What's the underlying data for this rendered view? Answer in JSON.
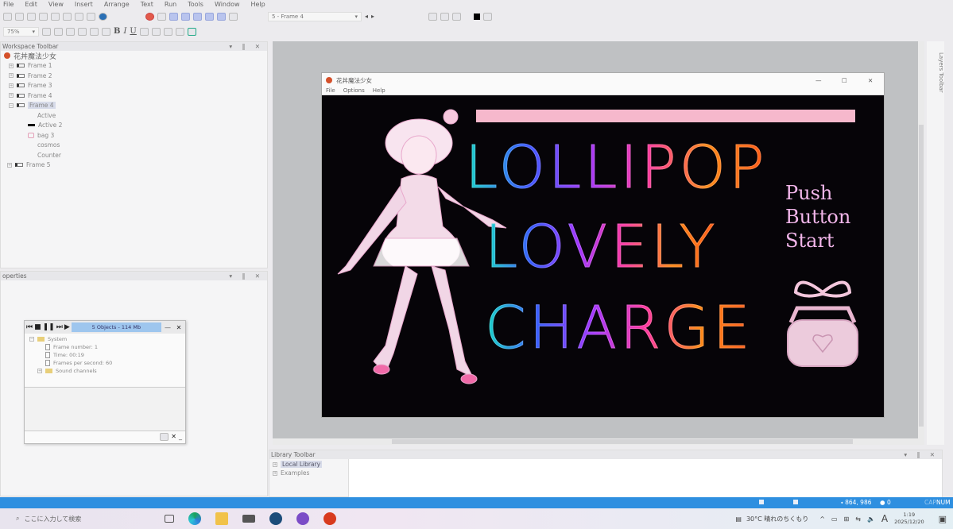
{
  "menu": [
    "File",
    "Edit",
    "View",
    "Insert",
    "Arrange",
    "Text",
    "Run",
    "Tools",
    "Window",
    "Help"
  ],
  "toolbar": {
    "zoom": "75%",
    "frame_select": "5 - Frame 4",
    "bold": "B",
    "italic": "I",
    "underline": "U"
  },
  "workspace": {
    "title": "Workspace Toolbar",
    "app_name": "花丼魔法少女",
    "frames": [
      "Frame 1",
      "Frame 2",
      "Frame 3",
      "Frame 4",
      "Frame 4",
      "Frame 5"
    ],
    "objects": [
      "Active",
      "Active 2",
      "bag 3",
      "cosmos",
      "Counter"
    ]
  },
  "properties": {
    "title": "operties"
  },
  "debugger": {
    "status": "5 Objects - 114 Mb",
    "system": "System",
    "items": [
      "Frame number: 1",
      "Time: 00:19",
      "Frames per second: 60"
    ],
    "sound": "Sound channels"
  },
  "game": {
    "title": "花丼魔法少女",
    "menu": [
      "File",
      "Options",
      "Help"
    ],
    "logo_lines": [
      "LOLLIPOP",
      "LOVELY",
      "CHARGE"
    ],
    "push": [
      "Push",
      "Button",
      "Start"
    ]
  },
  "layers": {
    "title": "Layers Toolbar"
  },
  "library": {
    "title": "Library Toolbar",
    "items": [
      "Local Library",
      "Examples"
    ]
  },
  "status": {
    "coords": "864, 986",
    "count": "0",
    "num": "NUM",
    "cap": "CAP"
  },
  "taskbar": {
    "search_placeholder": "ここに入力して検索",
    "weather": "30°C 晴れのちくもり",
    "ime": "A",
    "time": "1:19",
    "date": "2025/12/20"
  }
}
